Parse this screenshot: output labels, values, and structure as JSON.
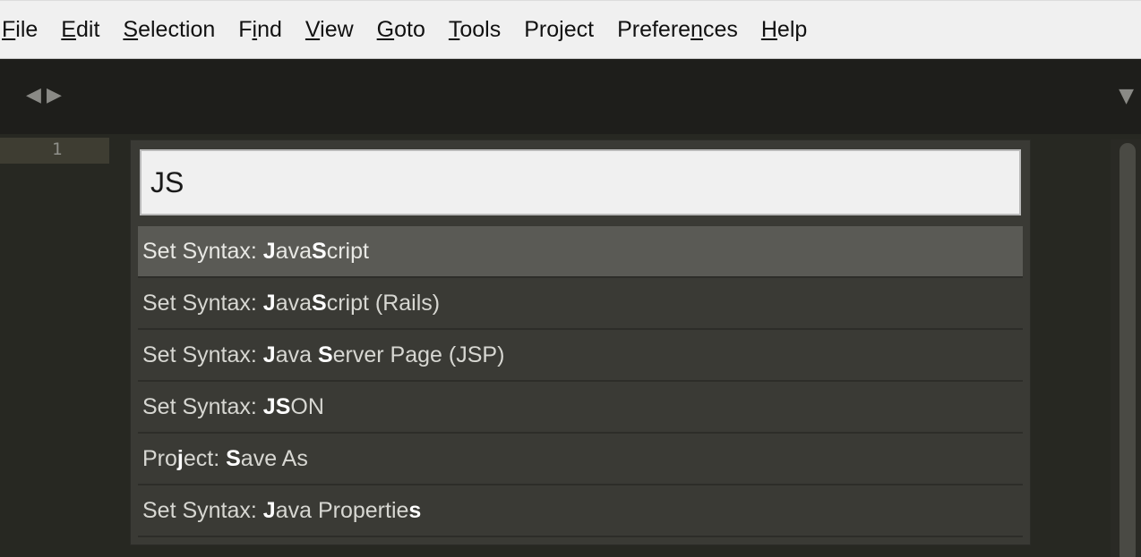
{
  "menu": {
    "items": [
      {
        "pre": "",
        "acc": "F",
        "post": "ile"
      },
      {
        "pre": "",
        "acc": "E",
        "post": "dit"
      },
      {
        "pre": "",
        "acc": "S",
        "post": "election"
      },
      {
        "pre": "F",
        "acc": "i",
        "post": "nd"
      },
      {
        "pre": "",
        "acc": "V",
        "post": "iew"
      },
      {
        "pre": "",
        "acc": "G",
        "post": "oto"
      },
      {
        "pre": "",
        "acc": "T",
        "post": "ools"
      },
      {
        "pre": "Project",
        "acc": "",
        "post": ""
      },
      {
        "pre": "Prefere",
        "acc": "n",
        "post": "ces"
      },
      {
        "pre": "",
        "acc": "H",
        "post": "elp"
      }
    ]
  },
  "tabbar": {
    "nav_left": "◀",
    "nav_right": "▶",
    "dropdown": "▼"
  },
  "editor": {
    "line_number": "1"
  },
  "palette": {
    "query": "JS",
    "results": [
      {
        "label": "Set Syntax: JavaScript",
        "parts": [
          "Set Syntax: ",
          "J",
          "ava",
          "S",
          "cript"
        ]
      },
      {
        "label": "Set Syntax: JavaScript (Rails)",
        "parts": [
          "Set Syntax: ",
          "J",
          "ava",
          "S",
          "cript (Rails)"
        ]
      },
      {
        "label": "Set Syntax: Java Server Page (JSP)",
        "parts": [
          "Set Syntax: ",
          "J",
          "ava ",
          "S",
          "erver Page (JSP)"
        ]
      },
      {
        "label": "Set Syntax: JSON",
        "parts": [
          "Set Syntax: ",
          "JS",
          "ON",
          "",
          ""
        ]
      },
      {
        "label": "Project: Save As",
        "parts": [
          "Pro",
          "j",
          "ect: ",
          "S",
          "ave As"
        ]
      },
      {
        "label": "Set Syntax: Java Properties",
        "parts": [
          "Set Syntax: ",
          "J",
          "ava Propertie",
          "s",
          ""
        ]
      }
    ],
    "selected_index": 0
  }
}
